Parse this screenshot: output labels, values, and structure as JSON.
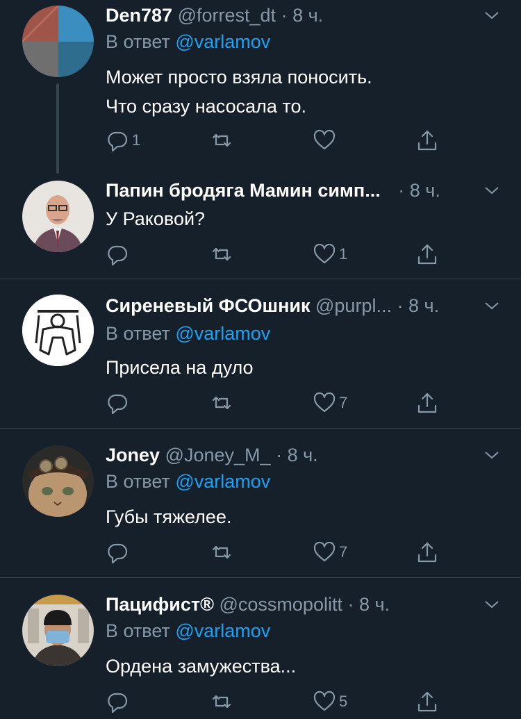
{
  "tweets": [
    {
      "name": "Den787",
      "handle": "@forrest_dt",
      "time": "8 ч.",
      "reply_prefix": "В ответ",
      "reply_to": "@varlamov",
      "text_lines": [
        "Может просто взяла поносить.",
        "Что сразу насосала то."
      ],
      "reply_count": "1",
      "like_count": ""
    },
    {
      "name": "Папин бродяга Мамин симп...",
      "handle": "",
      "time": "8 ч.",
      "reply_prefix": "",
      "reply_to": "",
      "text_lines": [
        "У Раковой?"
      ],
      "reply_count": "",
      "like_count": "1"
    },
    {
      "name": "Сиреневый ФСОшник",
      "handle": "@purpl...",
      "time": "8 ч.",
      "reply_prefix": "В ответ",
      "reply_to": "@varlamov",
      "text_lines": [
        "Присела на дуло"
      ],
      "reply_count": "",
      "like_count": "7"
    },
    {
      "name": "Joney",
      "handle": "@Joney_M_",
      "time": "8 ч.",
      "reply_prefix": "В ответ",
      "reply_to": "@varlamov",
      "text_lines": [
        "Губы тяжелее."
      ],
      "reply_count": "",
      "like_count": "7"
    },
    {
      "name": "Пацифист®",
      "handle": "@cossmopolitt",
      "time": "8 ч.",
      "reply_prefix": "В ответ",
      "reply_to": "@varlamov",
      "text_lines": [
        "Ордена замужества..."
      ],
      "reply_count": "",
      "like_count": "5"
    }
  ],
  "separator_dot": "·",
  "colors": {
    "background": "#15202b",
    "secondary_text": "#8899a6",
    "link": "#1da1f2",
    "divider": "#38444d"
  }
}
